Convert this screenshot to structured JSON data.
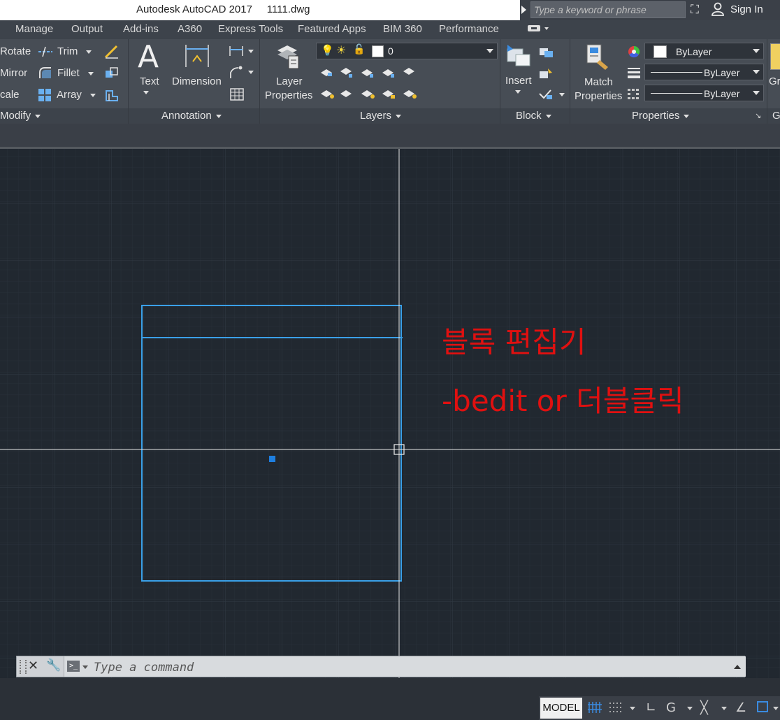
{
  "title_bar": {
    "app_title": "Autodesk AutoCAD 2017",
    "file_name": "1111.dwg",
    "search_placeholder": "Type a keyword or phrase",
    "sign_in": "Sign In"
  },
  "menu_tabs": [
    "Manage",
    "Output",
    "Add-ins",
    "A360",
    "Express Tools",
    "Featured Apps",
    "BIM 360",
    "Performance"
  ],
  "ribbon": {
    "modify": {
      "rotate": "Rotate",
      "mirror": "Mirror",
      "scale": "cale",
      "trim": "Trim",
      "fillet": "Fillet",
      "array": "Array",
      "panel_label": "Modify"
    },
    "annotation": {
      "text": "Text",
      "dimension": "Dimension",
      "panel_label": "Annotation"
    },
    "layers": {
      "layer_properties_line1": "Layer",
      "layer_properties_line2": "Properties",
      "current_layer": "0",
      "panel_label": "Layers"
    },
    "block": {
      "insert": "Insert",
      "panel_label": "Block"
    },
    "properties": {
      "match_line1": "Match",
      "match_line2": "Properties",
      "color": "ByLayer",
      "linetype": "ByLayer",
      "lineweight": "ByLayer",
      "panel_label": "Properties"
    },
    "groups": {
      "label_cut": "Gr",
      "panel_label_cut": "G"
    }
  },
  "drawing": {
    "annotation_line1": "블록 편집기",
    "annotation_line2": "-bedit or 더블클릭",
    "annotation_color": "#e01010",
    "entity_color": "#3aa0e8"
  },
  "command_line": {
    "placeholder": "Type a command"
  },
  "status_bar": {
    "model": "MODEL"
  },
  "colors": {
    "canvas_bg": "#212830",
    "ribbon_bg": "#474d55",
    "title_bg": "#ffffff"
  }
}
